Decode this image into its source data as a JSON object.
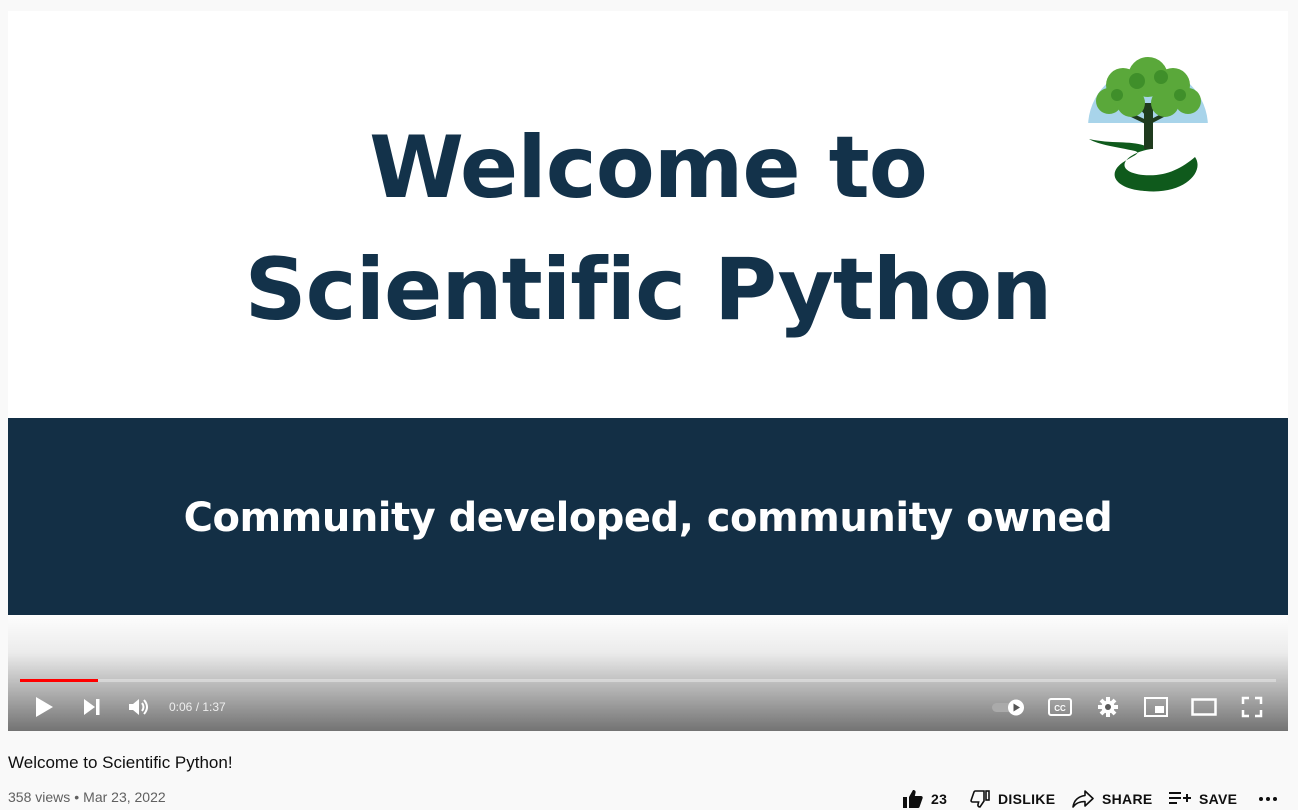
{
  "slide": {
    "title_line1": "Welcome to",
    "title_line2": "Scientific Python",
    "tagline": "Community developed, community owned"
  },
  "player": {
    "current_time": "0:06",
    "separator": " / ",
    "duration": "1:37",
    "progress_fraction": 0.062,
    "accent_color": "#ff0000",
    "controls": [
      "play-icon",
      "next-icon",
      "volume-icon",
      "autoplay-toggle",
      "subtitles-icon",
      "settings-icon",
      "miniplayer-icon",
      "theater-icon",
      "fullscreen-icon"
    ]
  },
  "video": {
    "title": "Welcome to Scientific Python!",
    "views": "358 views",
    "date": "Mar 23, 2022"
  },
  "actions": {
    "like_count": "23",
    "dislike_label": "DISLIKE",
    "share_label": "SHARE",
    "save_label": "SAVE"
  },
  "colors": {
    "slide_text": "#13324a",
    "band": "#132f45",
    "logo_green": "#2e7d32",
    "logo_sky": "#a8d4ea"
  }
}
